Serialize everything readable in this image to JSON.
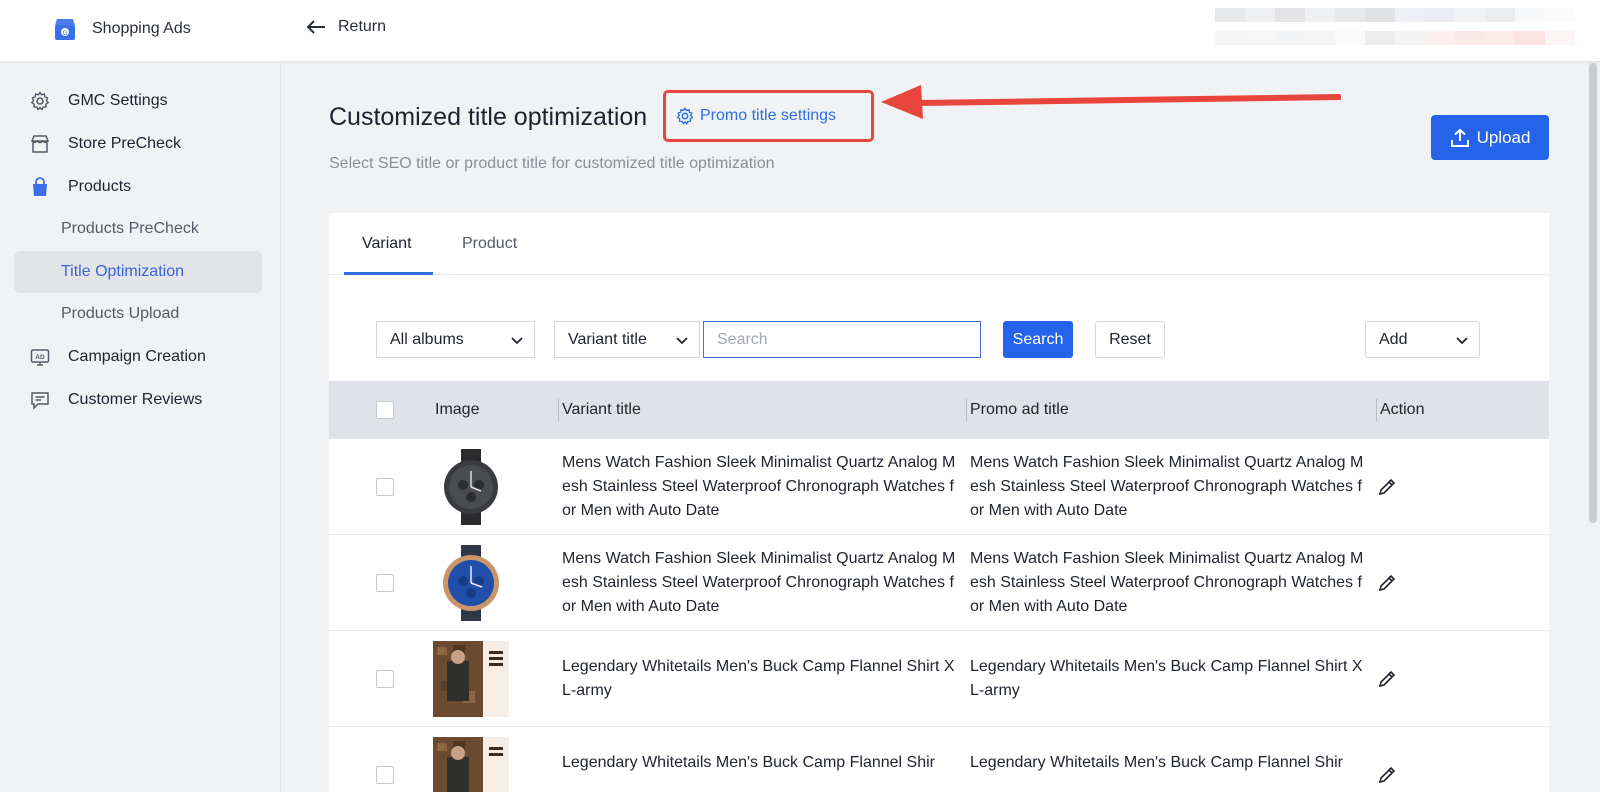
{
  "app": {
    "name": "Shopping Ads",
    "return_label": "Return"
  },
  "sidebar": {
    "items": [
      {
        "label": "GMC Settings",
        "icon": "gear-icon"
      },
      {
        "label": "Store PreCheck",
        "icon": "store-icon"
      },
      {
        "label": "Products",
        "icon": "shopping-bag-icon"
      },
      {
        "label": "Products PreCheck"
      },
      {
        "label": "Title Optimization",
        "active": true
      },
      {
        "label": "Products Upload"
      },
      {
        "label": "Campaign Creation",
        "icon": "ad-icon"
      },
      {
        "label": "Customer Reviews",
        "icon": "comment-icon"
      }
    ]
  },
  "header": {
    "title": "Customized title optimization",
    "promo_settings_label": "Promo title settings",
    "subtitle": "Select SEO title or product title for customized title optimization",
    "upload_label": "Upload"
  },
  "tabs": [
    {
      "label": "Variant",
      "active": true
    },
    {
      "label": "Product",
      "active": false
    }
  ],
  "filters": {
    "album_select": "All albums",
    "field_select": "Variant title",
    "search_placeholder": "Search",
    "search_button": "Search",
    "reset_button": "Reset",
    "add_select": "Add"
  },
  "table": {
    "columns": [
      "Image",
      "Variant title",
      "Promo ad title",
      "Action"
    ],
    "rows": [
      {
        "image": "black-watch",
        "variant_title": "Mens Watch Fashion Sleek Minimalist Quartz Analog Mesh Stainless Steel Waterproof Chronograph Watches for Men with Auto Date",
        "promo_title": "Mens Watch Fashion Sleek Minimalist Quartz Analog Mesh Stainless Steel Waterproof Chronograph Watches for Men with Auto Date"
      },
      {
        "image": "blue-gold-watch",
        "variant_title": "Mens Watch Fashion Sleek Minimalist Quartz Analog Mesh Stainless Steel Waterproof Chronograph Watches for Men with Auto Date",
        "promo_title": "Mens Watch Fashion Sleek Minimalist Quartz Analog Mesh Stainless Steel Waterproof Chronograph Watches for Men with Auto Date"
      },
      {
        "image": "flannel-shirt",
        "variant_title": "Legendary Whitetails Men's Buck Camp Flannel Shirt XL-army",
        "promo_title": "Legendary Whitetails Men's Buck Camp Flannel Shirt XL-army"
      },
      {
        "image": "flannel-shirt",
        "variant_title": "Legendary Whitetails Men's Buck Camp Flannel Shir",
        "promo_title": "Legendary Whitetails Men's Buck Camp Flannel Shir"
      }
    ]
  },
  "colors": {
    "accent": "#2563eb",
    "annotation": "#e8453c",
    "link": "#2f6fe0"
  }
}
